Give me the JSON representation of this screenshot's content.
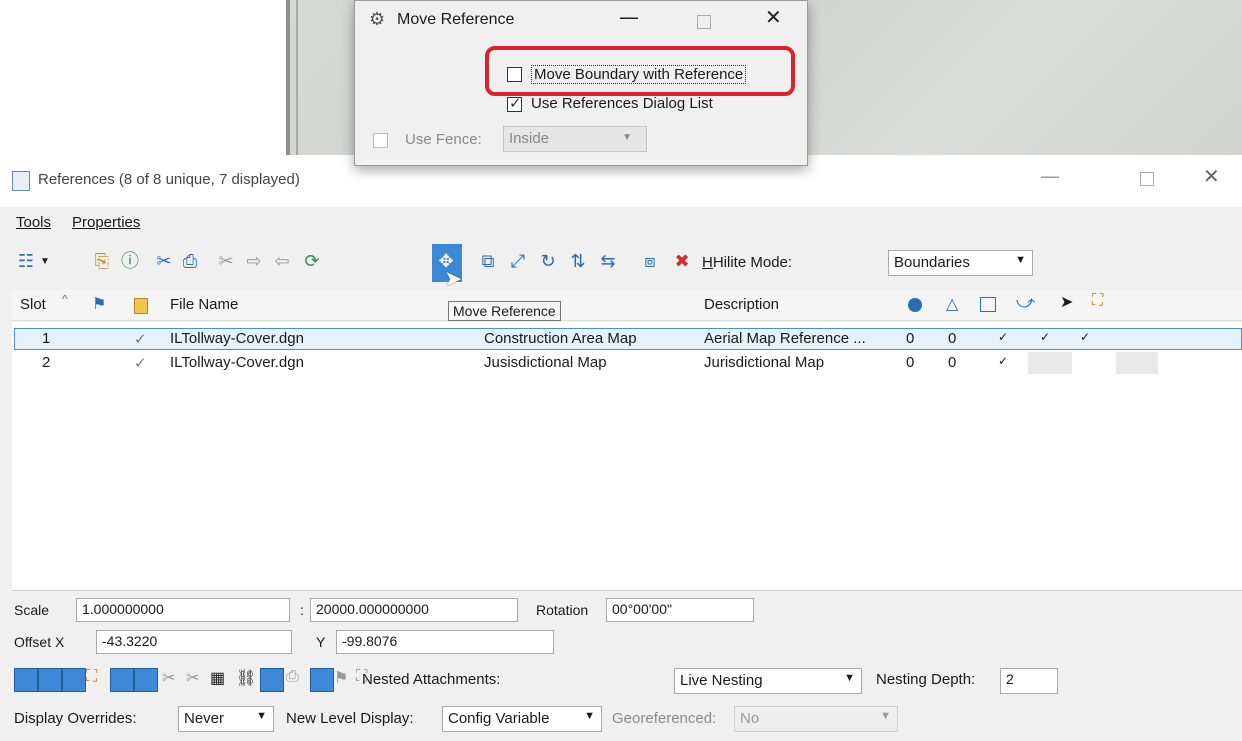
{
  "move_dialog": {
    "title": "Move Reference",
    "move_boundary_label": "Move Boundary with Reference",
    "move_boundary_checked": false,
    "use_list_label": "Use References Dialog List",
    "use_list_checked": true,
    "use_fence_label": "Use Fence:",
    "use_fence_value": "Inside"
  },
  "references_window": {
    "title": "References (8 of 8 unique, 7 displayed)",
    "menu": [
      "Tools",
      "Properties"
    ],
    "hilite_label": "Hilite Mode:",
    "hilite_value": "Boundaries",
    "tooltip": "Move Reference",
    "columns": {
      "slot": "Slot",
      "file_name": "File Name",
      "description": "Description"
    },
    "rows": [
      {
        "slot": "1",
        "check": "✓",
        "file": "ILTollway-Cover.dgn",
        "logical": "Construction Area Map",
        "description": "Aerial Map Reference ...",
        "c1": "0",
        "c2": "0",
        "marks": [
          "✓",
          "✓",
          "✓"
        ]
      },
      {
        "slot": "2",
        "check": "✓",
        "file": "ILTollway-Cover.dgn",
        "logical": "Jusisdictional Map",
        "description": "Jurisdictional Map",
        "c1": "0",
        "c2": "0",
        "marks": [
          "✓"
        ]
      }
    ]
  },
  "props": {
    "scale_label": "Scale",
    "scale_value": "1.000000000",
    "colon": ":",
    "scale_value2": "20000.000000000",
    "rotation_label": "Rotation",
    "rotation_value": "00°00'00\"",
    "offset_x_label": "Offset X",
    "offset_x_value": "-43.3220",
    "y_label": "Y",
    "y_value": "-99.8076",
    "nested_label": "Nested Attachments:",
    "nested_value": "Live Nesting",
    "depth_label": "Nesting Depth:",
    "depth_value": "2",
    "overrides_label": "Display Overrides:",
    "overrides_value": "Never",
    "newlevel_label": "New Level Display:",
    "newlevel_value": "Config Variable",
    "geo_label": "Georeferenced:",
    "geo_value": "No"
  },
  "colors": {
    "highlight": "#e0202a",
    "selection": "#e5f1fb",
    "accent": "#2a6db5"
  }
}
